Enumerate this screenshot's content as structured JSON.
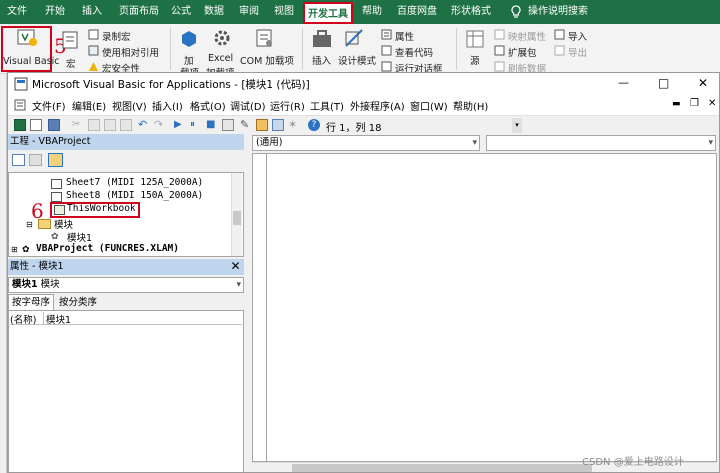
{
  "excel": {
    "tabs": [
      "文件",
      "开始",
      "插入",
      "页面布局",
      "公式",
      "数据",
      "审阅",
      "视图",
      "开发工具",
      "帮助",
      "百度网盘",
      "形状格式",
      "操作说明搜索"
    ],
    "ribbon": {
      "visual_basic": "Visual Basic",
      "macros": "宏",
      "record_macro": "录制宏",
      "relative_ref": "使用相对引用",
      "macro_security": "宏安全性",
      "addins": "加",
      "addins2": "载项",
      "excel_addins": "Excel",
      "excel_addins2": "加载项",
      "com_addins": "COM 加载项",
      "insert": "插入",
      "design_mode": "设计模式",
      "properties": "属性",
      "view_code": "查看代码",
      "run_dialog": "运行对话框",
      "source": "源",
      "map_props": "映射属性",
      "expansion": "扩展包",
      "refresh_data": "刷新数据",
      "import": "导入",
      "export": "导出"
    },
    "annotations": [
      "5",
      "6"
    ]
  },
  "vbe": {
    "title": "Microsoft Visual Basic for Applications - [模块1 (代码)]",
    "window_min": "—",
    "window_max": "□",
    "window_close": "✕",
    "menu": [
      "文件(F)",
      "编辑(E)",
      "视图(V)",
      "插入(I)",
      "格式(O)",
      "调试(D)",
      "运行(R)",
      "工具(T)",
      "外接程序(A)",
      "窗口(W)",
      "帮助(H)"
    ],
    "position": "行 1，列 18",
    "project": {
      "title": "工程 - VBAProject",
      "items": [
        "Sheet7 (MIDI 125A_2000A)",
        "Sheet8 (MIDI 150A_2000A)",
        "ThisWorkbook",
        "模块",
        "模块1",
        "VBAProject (FUNCRES.XLAM)"
      ]
    },
    "properties": {
      "title": "属性 - 模块1",
      "object": "模块1",
      "object_type": "模块",
      "tabs": [
        "按字母序",
        "按分类序"
      ],
      "name_key": "(名称)",
      "name_value": "模块1"
    },
    "code": {
      "object_combo": "(通用)",
      "proc_combo": ""
    }
  },
  "watermark": "CSDN @爱上电路设计"
}
